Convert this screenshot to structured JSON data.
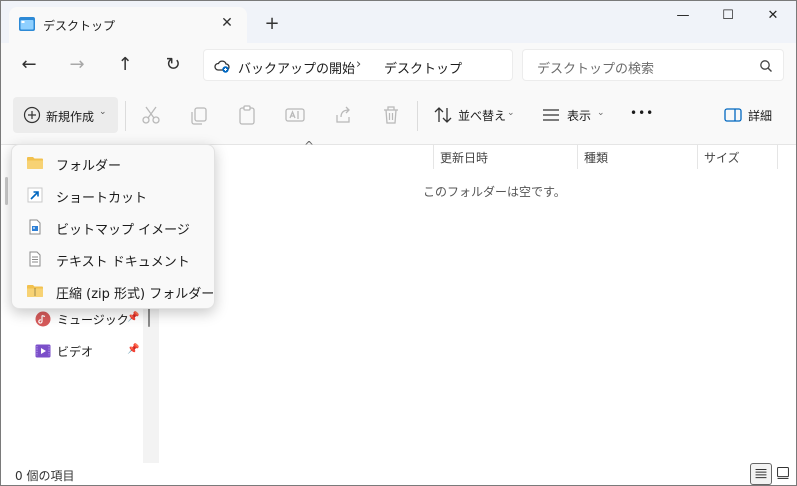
{
  "window": {
    "tab_title": "デスクトップ",
    "tab_close": "✕",
    "new_tab": "+",
    "minimize": "—",
    "maximize": "☐",
    "close": "✕"
  },
  "address": {
    "back": "←",
    "forward": "→",
    "up": "↑",
    "refresh": "↻",
    "breadcrumb": [
      "バックアップの開始",
      "デスクトップ"
    ],
    "crumb_sep": "›",
    "search_placeholder": "デスクトップの検索"
  },
  "toolbar": {
    "new_label": "新規作成",
    "chevron": "⌄",
    "sort_label": "並べ替え",
    "view_label": "表示",
    "more": "•••",
    "details_label": "詳細"
  },
  "new_menu": {
    "items": [
      {
        "label": "フォルダー",
        "icon": "folder-icon"
      },
      {
        "label": "ショートカット",
        "icon": "shortcut-icon"
      },
      {
        "label": "ビットマップ イメージ",
        "icon": "bitmap-icon"
      },
      {
        "label": "テキスト ドキュメント",
        "icon": "text-document-icon"
      },
      {
        "label": "圧縮 (zip 形式) フォルダー",
        "icon": "zip-folder-icon"
      }
    ]
  },
  "sidebar": {
    "items": [
      {
        "label": "ミュージック",
        "icon": "music-icon",
        "pinned": true
      },
      {
        "label": "ビデオ",
        "icon": "video-icon",
        "pinned": true
      }
    ],
    "pin_glyph": "📌"
  },
  "columns": {
    "sort_caret": "^",
    "headers": [
      "更新日時",
      "種類",
      "サイズ"
    ]
  },
  "main": {
    "empty_message": "このフォルダーは空です。"
  },
  "status": {
    "item_count": "0 個の項目"
  },
  "colors": {
    "accent": "#0067c0",
    "folder": "#f2c14e",
    "music": "#d65a5a",
    "video": "#7b4fc9"
  }
}
